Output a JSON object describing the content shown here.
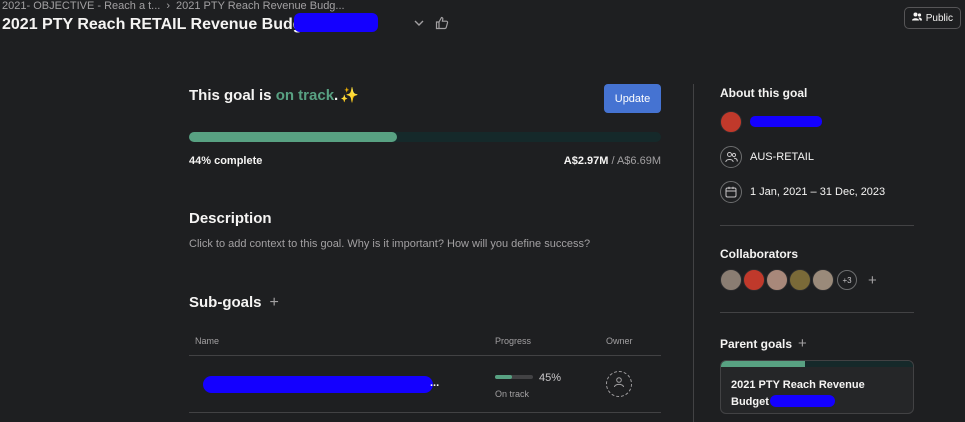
{
  "breadcrumb": {
    "items": [
      "2021- OBJECTIVE - Reach a t...",
      "2021 PTY Reach Revenue Budg..."
    ]
  },
  "page": {
    "title": "2021 PTY Reach RETAIL Revenue Budget"
  },
  "header": {
    "public_label": "Public"
  },
  "goal": {
    "status_prefix": "This goal is ",
    "status_value": "on track",
    "status_suffix": ".",
    "sparkle": "✨",
    "update_label": "Update",
    "progress_fraction": 0.44,
    "percent_label": "44% complete",
    "current_amount": "A$2.97M",
    "separator": " / ",
    "target_amount": "A$6.69M"
  },
  "description": {
    "heading": "Description",
    "placeholder": "Click to add context to this goal. Why is it important? How will you define success?"
  },
  "subgoals": {
    "heading": "Sub-goals",
    "columns": {
      "name": "Name",
      "progress": "Progress",
      "owner": "Owner"
    },
    "rows": [
      {
        "name_suffix": "...",
        "progress_fraction": 0.45,
        "progress_label": "45%",
        "status": "On track"
      }
    ]
  },
  "about": {
    "heading": "About this goal",
    "team": "AUS-RETAIL",
    "dates": "1 Jan, 2021 – 31 Dec, 2023"
  },
  "collaborators": {
    "heading": "Collaborators",
    "more_label": "+3",
    "avatar_colors": [
      "#8a7d72",
      "#c0392b",
      "#a8887a",
      "#7a6a38",
      "#9a8a7a"
    ]
  },
  "parent_goals": {
    "heading": "Parent goals",
    "card_title": "2021 PTY Reach Revenue Budget",
    "card_progress_fraction": 0.44
  },
  "colors": {
    "accent_green": "#58a182",
    "update_blue": "#4573d2",
    "background": "#1e1f21"
  }
}
